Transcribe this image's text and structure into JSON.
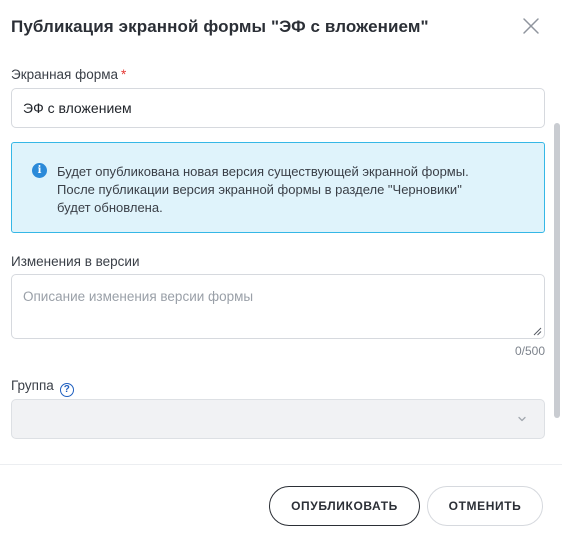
{
  "dialog": {
    "title": "Публикация экранной формы \"ЭФ с вложением\""
  },
  "form": {
    "screen_form_label": "Экранная форма",
    "required_mark": "*",
    "screen_form_value": "ЭФ с вложением",
    "info_lines": [
      "Будет опубликована новая версия существующей экранной формы.",
      "После публикации версия экранной формы в разделе \"Черновики\"",
      "будет обновлена."
    ],
    "changes_label": "Изменения в версии",
    "changes_placeholder": "Описание изменения версии формы",
    "changes_counter": "0/500",
    "group_label": "Группа",
    "group_help_glyph": "?",
    "group_value": ""
  },
  "footer": {
    "publish_label": "ОПУБЛИКОВАТЬ",
    "cancel_label": "ОТМЕНИТЬ"
  },
  "icons": {
    "close": "close-icon",
    "info": "info-icon",
    "help": "help-icon",
    "chevron": "chevron-down-icon"
  },
  "colors": {
    "info_background": "#dff3fb",
    "info_border": "#35b7e6",
    "info_icon": "#2b8ad9",
    "required": "#e53935",
    "help_icon": "#1f5fbf"
  }
}
